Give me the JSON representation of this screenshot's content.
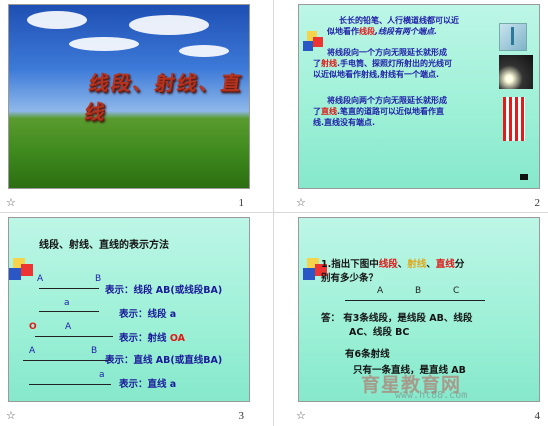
{
  "slides": [
    {
      "number": "1",
      "title": "线段、射线、直线"
    },
    {
      "number": "2",
      "p1": [
        "长长的铅笔、人行横道线都可以近",
        "似地看作",
        "线段",
        ",线段有两个端点."
      ],
      "p2": [
        "将线段向一个方向无限延长就形成",
        "了",
        "射线",
        ".手电筒、探照灯所射出的光线可",
        "以近似地看作射线,射线有一个端点."
      ],
      "p3": [
        "将线段向两个方向无限延长就形成",
        "了",
        "直线",
        ".笔直的道路可以近似地看作直",
        "线.直线没有端点."
      ]
    },
    {
      "number": "3",
      "heading": "线段、射线、直线的表示方法",
      "rows": [
        {
          "left": "A",
          "right": "B",
          "text": "表示：线段 AB(或线段BA)"
        },
        {
          "left": "a",
          "text": "表示：线段 a"
        },
        {
          "left": "O",
          "mid": "A",
          "text": "表示：射线 ",
          "extra": "OA"
        },
        {
          "left": "A",
          "right": "B",
          "text": "表示：直线 AB(或直线BA)"
        },
        {
          "left": "a",
          "text": "表示：直线 a"
        }
      ]
    },
    {
      "number": "4",
      "question_prefix": "1.指出下图中",
      "w1": "线段",
      "w2": "射线",
      "w3": "直线",
      "question_suffix": "分",
      "question_line2": "别有多少条？",
      "points": [
        "A",
        "B",
        "C"
      ],
      "answer1": "答：  有3条线段，是线段 AB、线段",
      "answer2": "AC、线段 BC",
      "answer3": "有6条射线",
      "answer4": "只有一条直线，是直线 AB",
      "watermark": "育星教育网",
      "watermark_url": "www.ht88.com"
    }
  ],
  "star_icon": "☆"
}
